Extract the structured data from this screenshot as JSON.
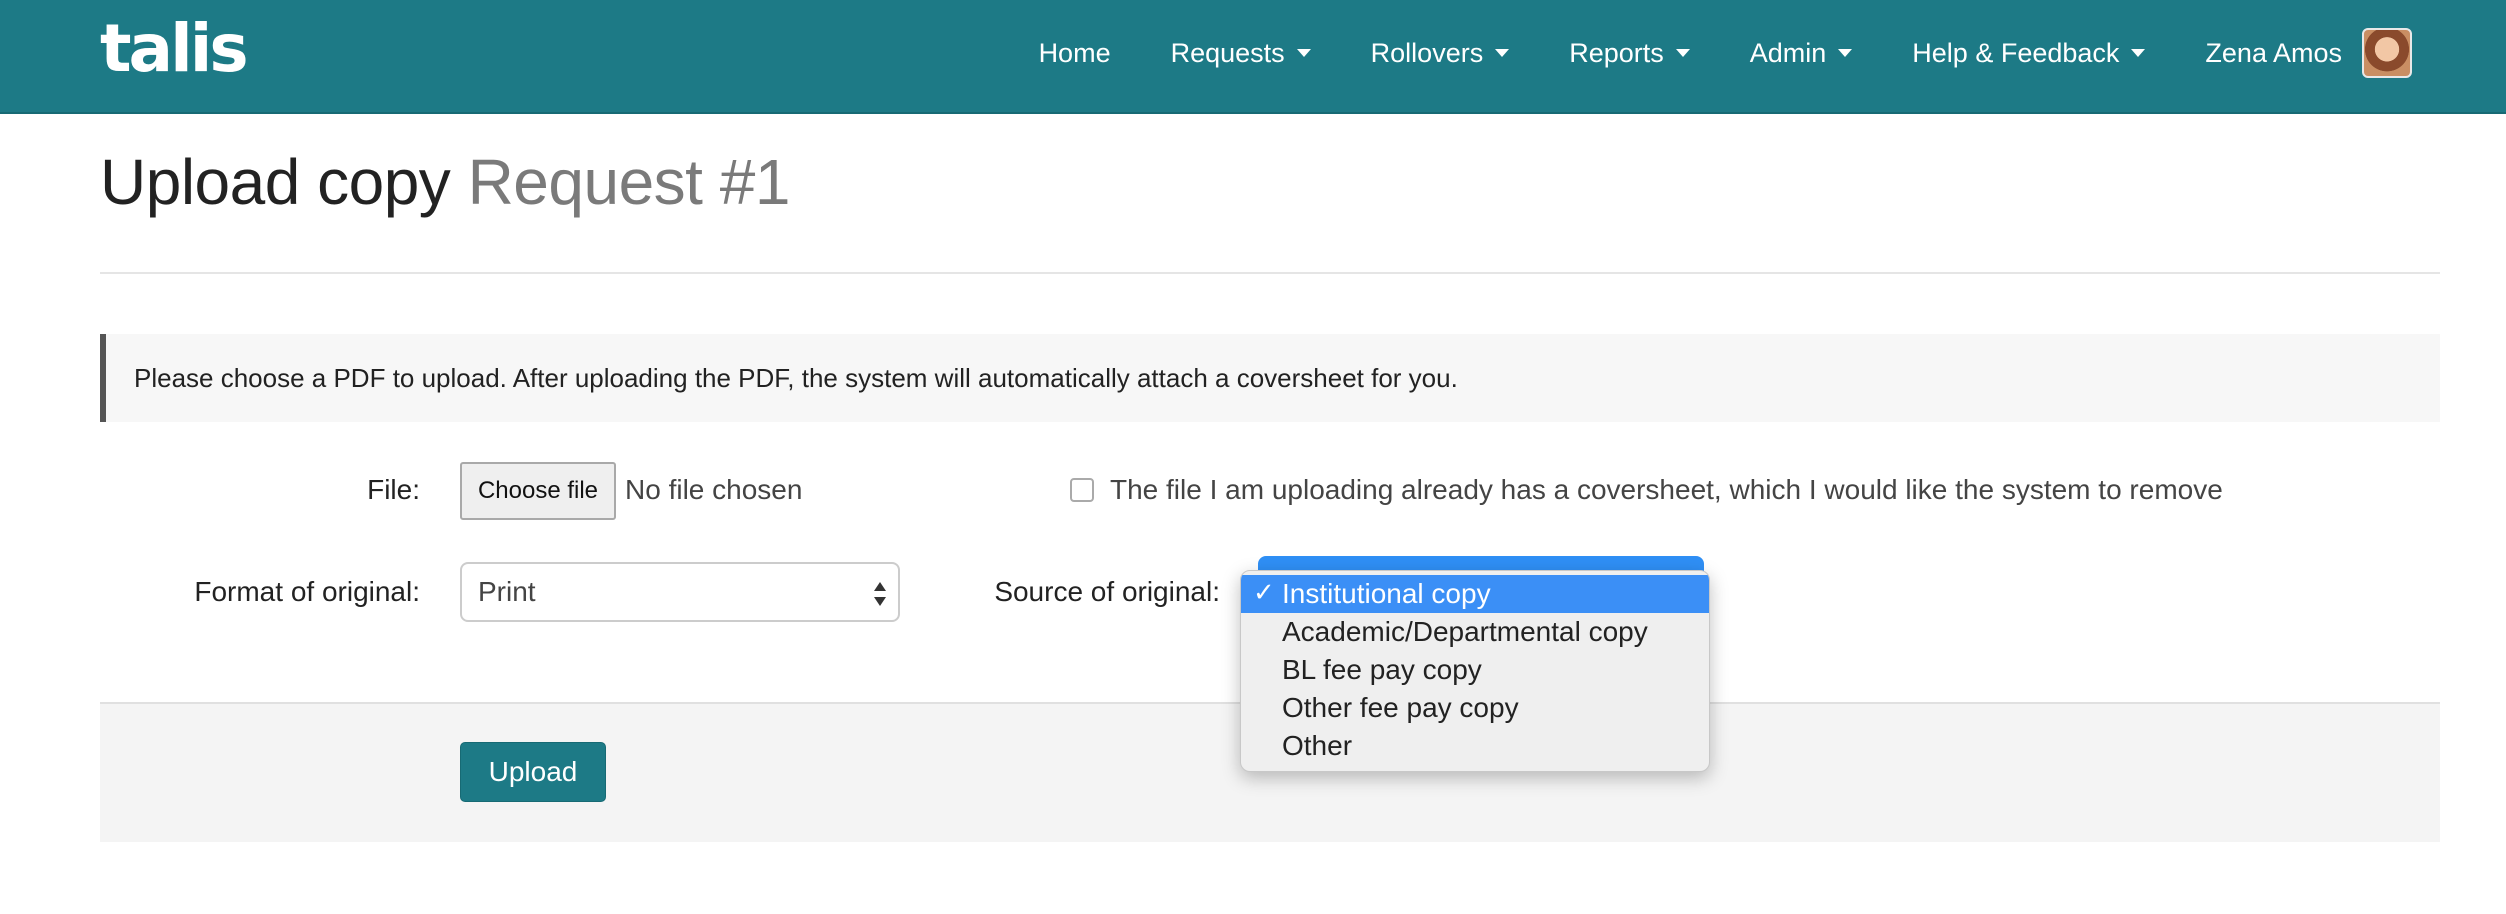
{
  "brand": {
    "logo_text": "talis",
    "color": "#1d7a86"
  },
  "nav": {
    "items": [
      {
        "label": "Home",
        "dropdown": false
      },
      {
        "label": "Requests",
        "dropdown": true
      },
      {
        "label": "Rollovers",
        "dropdown": true
      },
      {
        "label": "Reports",
        "dropdown": true
      },
      {
        "label": "Admin",
        "dropdown": true
      },
      {
        "label": "Help & Feedback",
        "dropdown": true
      }
    ],
    "user": {
      "name": "Zena Amos",
      "avatar_icon": "user-avatar"
    }
  },
  "page": {
    "title": "Upload copy",
    "subtitle": "Request #1"
  },
  "notice": {
    "text": "Please choose a PDF to upload. After uploading the PDF, the system will automatically attach a coversheet for you."
  },
  "form": {
    "file": {
      "label": "File:",
      "button_label": "Choose file",
      "status": "No file chosen"
    },
    "coversheet": {
      "checked": false,
      "label": "The file I am uploading already has a coversheet, which I would like the system to remove"
    },
    "format": {
      "label": "Format of original:",
      "value": "Print"
    },
    "source": {
      "label": "Source of original:",
      "selected": "Institutional copy",
      "options": [
        {
          "label": "Institutional copy",
          "selected": true
        },
        {
          "label": "Academic/Departmental copy",
          "selected": false
        },
        {
          "label": "BL fee pay copy",
          "selected": false
        },
        {
          "label": "Other fee pay copy",
          "selected": false
        },
        {
          "label": "Other",
          "selected": false
        }
      ],
      "highlight_color": "#3b8ff6"
    },
    "submit_label": "Upload"
  }
}
